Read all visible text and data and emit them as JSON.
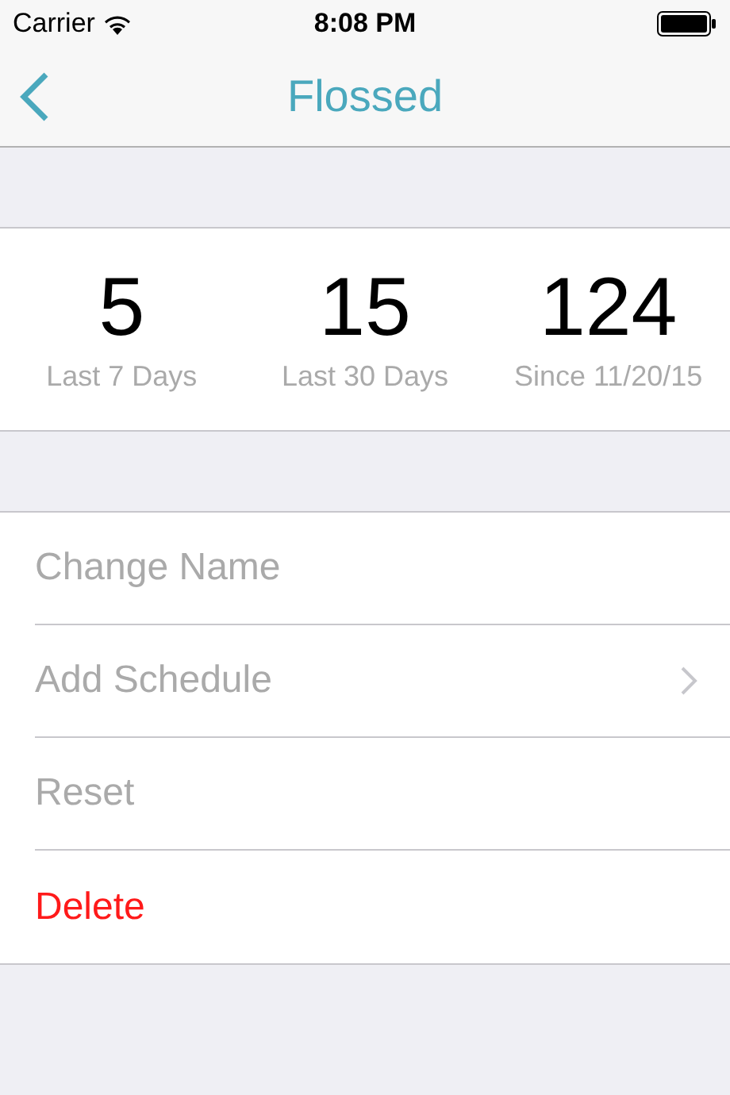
{
  "status_bar": {
    "carrier": "Carrier",
    "time": "8:08 PM"
  },
  "nav_bar": {
    "title": "Flossed"
  },
  "stats": [
    {
      "value": "5",
      "label": "Last 7 Days"
    },
    {
      "value": "15",
      "label": "Last 30 Days"
    },
    {
      "value": "124",
      "label": "Since 11/20/15"
    }
  ],
  "menu_items": [
    {
      "label": "Change Name",
      "kind": "normal",
      "disclosure": false
    },
    {
      "label": "Add Schedule",
      "kind": "normal",
      "disclosure": true
    },
    {
      "label": "Reset",
      "kind": "normal",
      "disclosure": false
    },
    {
      "label": "Delete",
      "kind": "destructive",
      "disclosure": false
    }
  ]
}
